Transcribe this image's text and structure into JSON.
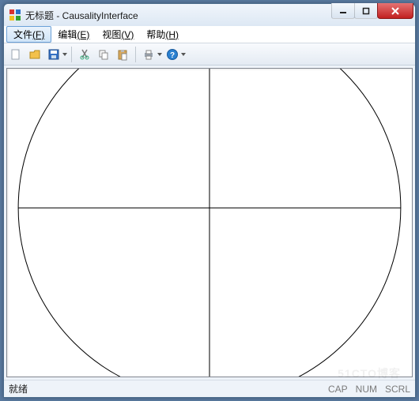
{
  "window": {
    "title": "无标题 - CausalityInterface"
  },
  "menu": {
    "file": {
      "label": "文件",
      "mnemonic": "(F)"
    },
    "edit": {
      "label": "编辑",
      "mnemonic": "(E)"
    },
    "view": {
      "label": "视图",
      "mnemonic": "(V)"
    },
    "help": {
      "label": "帮助",
      "mnemonic": "(H)"
    }
  },
  "toolbar": {
    "icons": {
      "new": "new-icon",
      "open": "open-icon",
      "save": "save-icon",
      "cut": "cut-icon",
      "copy": "copy-icon",
      "paste": "paste-icon",
      "print": "print-icon",
      "help": "help-icon"
    }
  },
  "status": {
    "ready": "就绪",
    "cap": "CAP",
    "num": "NUM",
    "scrl": "SCRL"
  },
  "watermark": "51CTO博客"
}
